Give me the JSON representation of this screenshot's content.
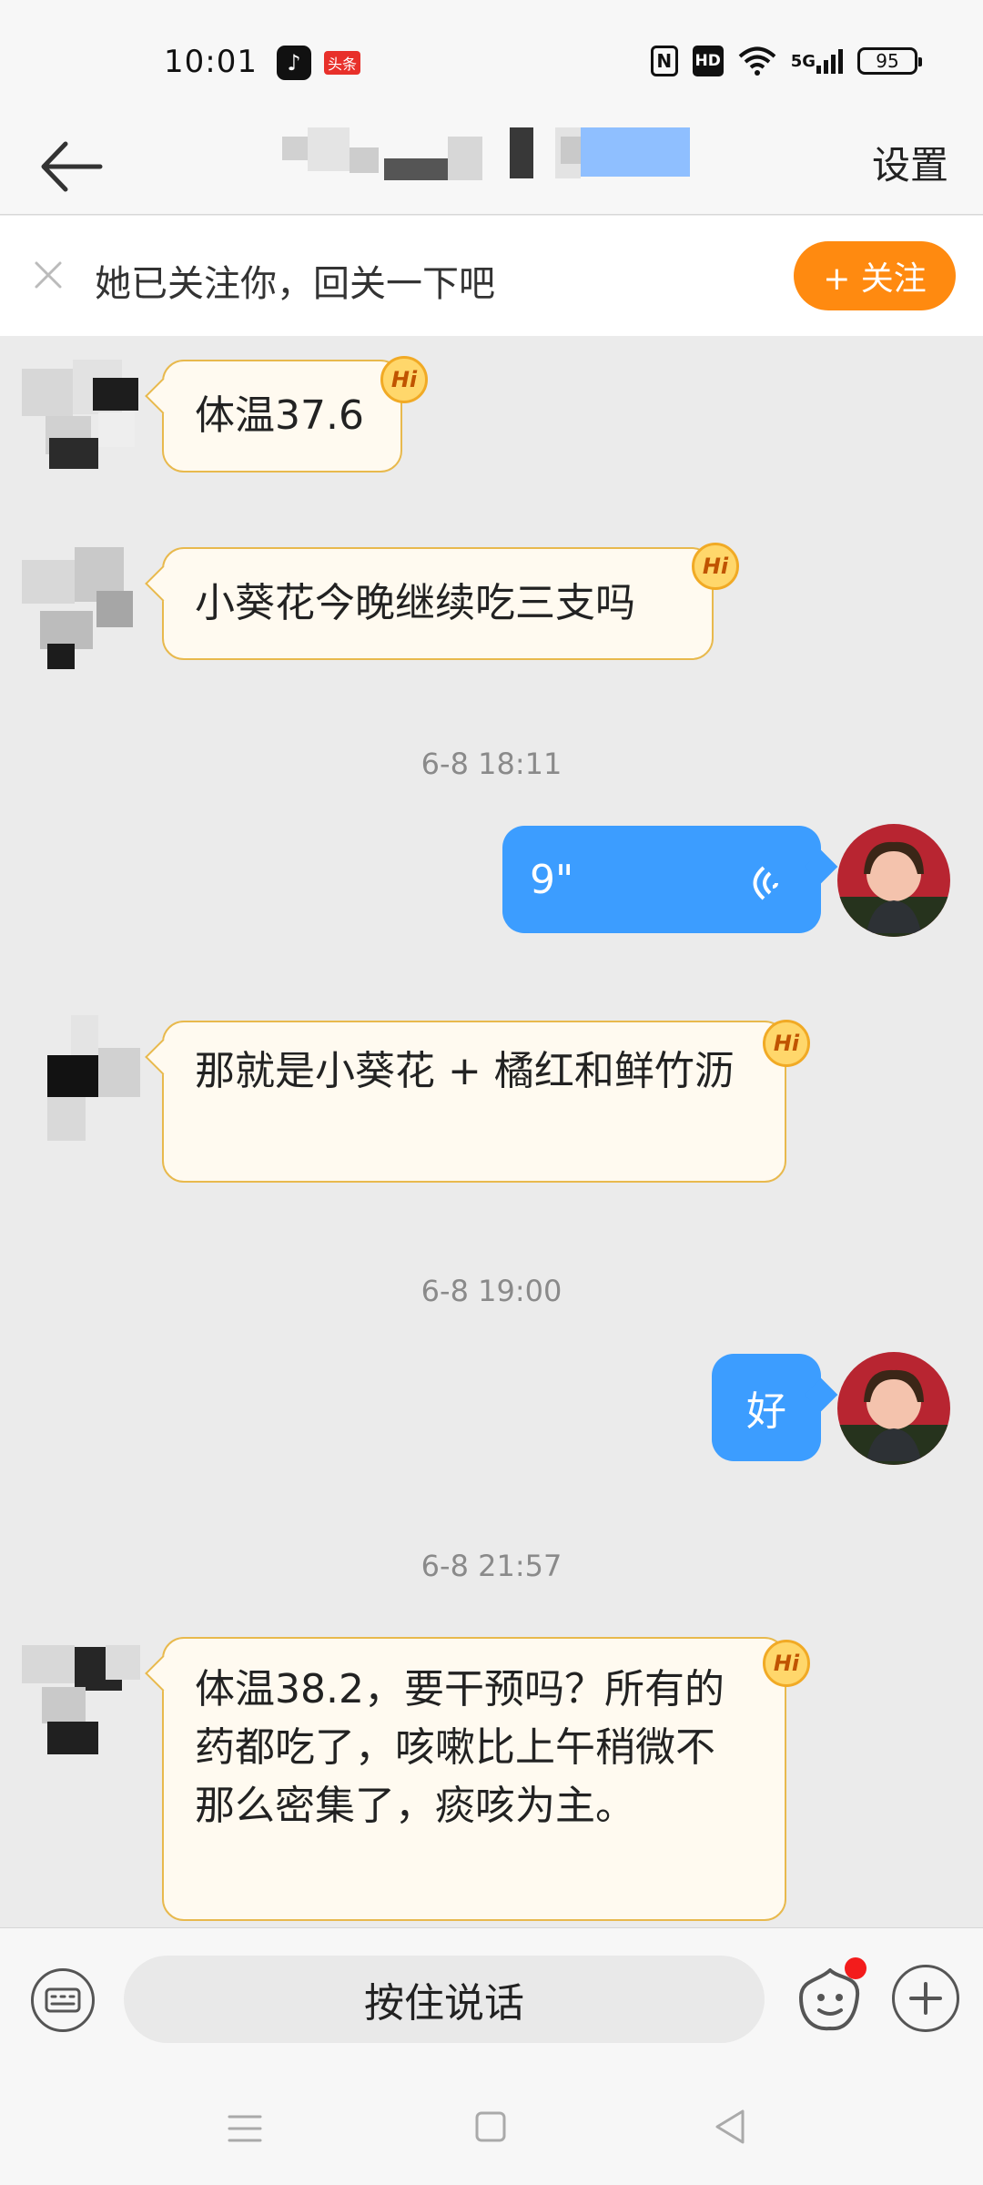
{
  "status_bar": {
    "time": "10:01",
    "app_icons": [
      "tiktok-icon",
      "toutiao-icon"
    ],
    "toutiao_label": "头条",
    "network_label": "5G",
    "battery": "95"
  },
  "header": {
    "back_icon": "arrow-left-icon",
    "settings_label": "设置"
  },
  "banner": {
    "close_icon": "close-icon",
    "text": "她已关注你，回关一下吧",
    "follow_button": "+ 关注"
  },
  "messages": [
    {
      "side": "incoming",
      "text": "体温37.6",
      "badge": "Hi"
    },
    {
      "side": "incoming",
      "text": "小葵花今晚继续吃三支吗",
      "badge": "Hi"
    },
    {
      "type": "time",
      "text": "6-8 18:11"
    },
    {
      "side": "outgoing",
      "type": "voice",
      "duration": "9\""
    },
    {
      "side": "incoming",
      "text": "那就是小葵花 + 橘红和鲜竹沥",
      "badge": "Hi"
    },
    {
      "type": "time",
      "text": "6-8 19:00"
    },
    {
      "side": "outgoing",
      "text": "好"
    },
    {
      "type": "time",
      "text": "6-8 21:57"
    },
    {
      "side": "incoming",
      "text": "体温38.2，要干预吗？所有的药都吃了，咳嗽比上午稍微不那么密集了，痰咳为主。",
      "badge": "Hi"
    }
  ],
  "composer": {
    "keyboard_icon": "keyboard-icon",
    "hold_to_talk": "按住说话",
    "emoji_icon": "emoji-icon",
    "add_icon": "plus-icon",
    "notification_color": "#f31c1c"
  },
  "navbar": {
    "menu_icon": "menu-icon",
    "home_icon": "home-icon",
    "back_icon": "back-triangle-icon"
  },
  "colors": {
    "follow": "#ff8a10",
    "outgoing_bubble": "#3c9dff",
    "incoming_border": "#e8b94d"
  }
}
